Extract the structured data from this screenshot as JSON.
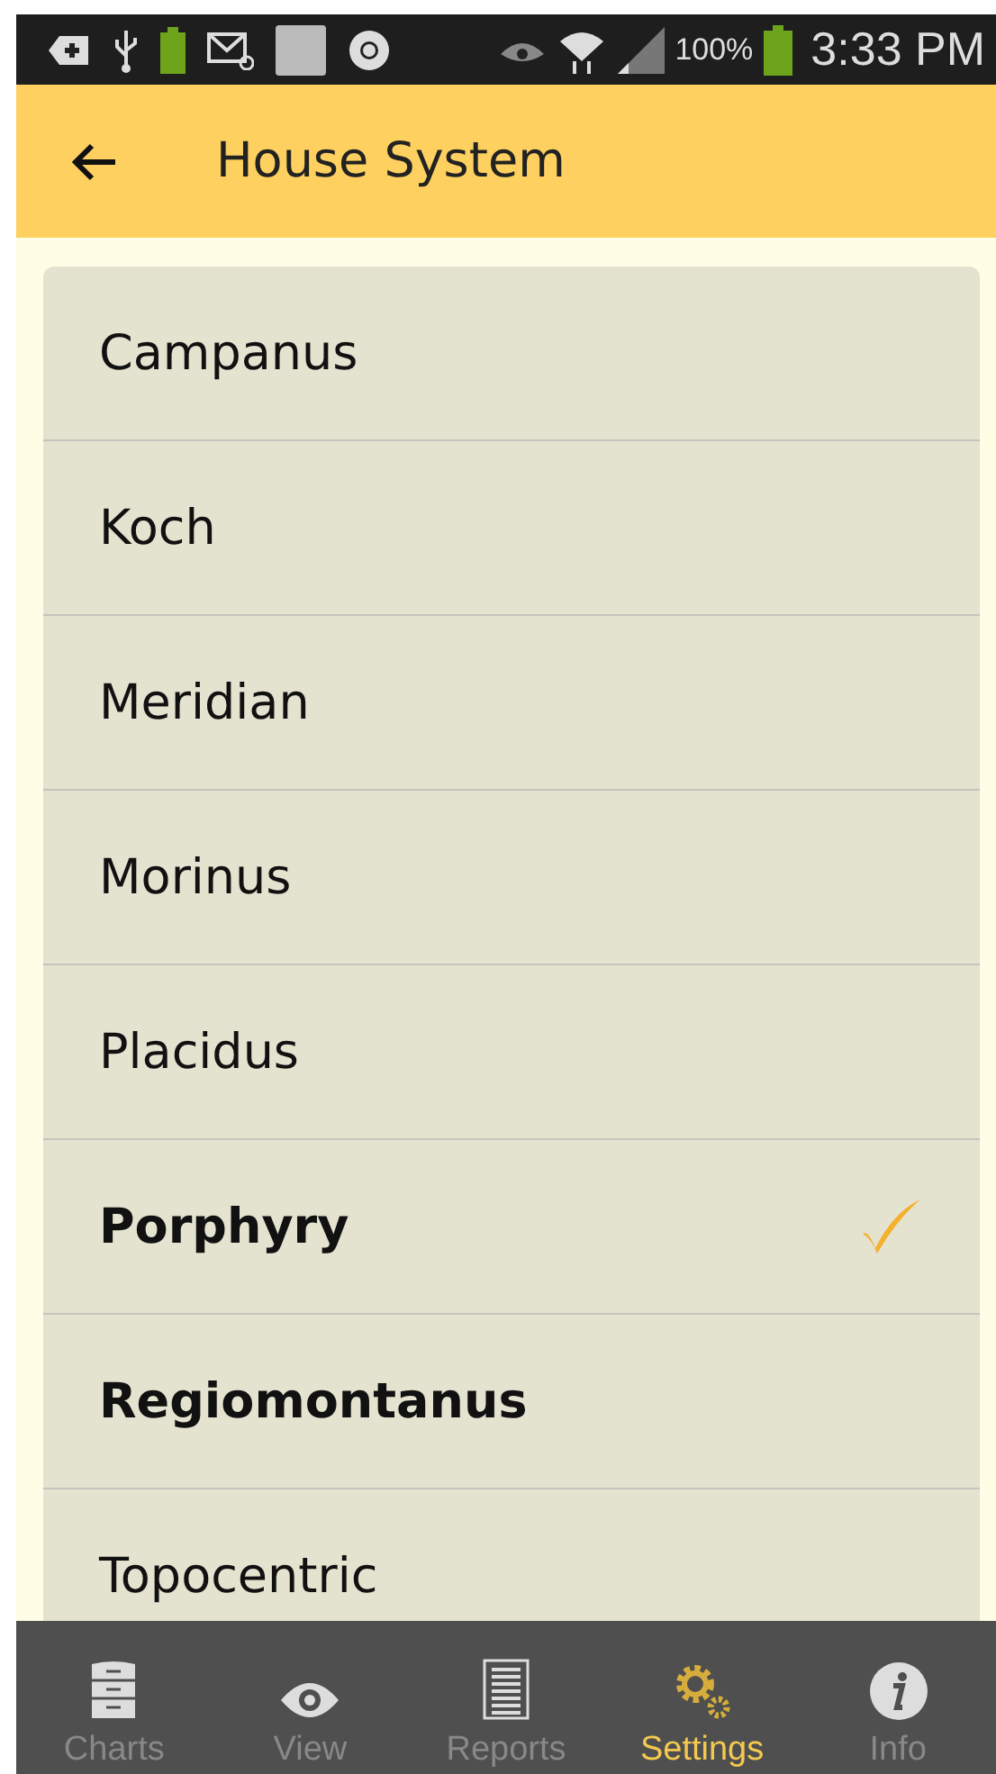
{
  "status_bar": {
    "battery": "100%",
    "time": "3:33 PM"
  },
  "app_bar": {
    "title": "House System"
  },
  "options": [
    {
      "label": "Campanus",
      "selected": false,
      "bold": false
    },
    {
      "label": "Koch",
      "selected": false,
      "bold": false
    },
    {
      "label": "Meridian",
      "selected": false,
      "bold": false
    },
    {
      "label": "Morinus",
      "selected": false,
      "bold": false
    },
    {
      "label": "Placidus",
      "selected": false,
      "bold": false
    },
    {
      "label": "Porphyry",
      "selected": true,
      "bold": true
    },
    {
      "label": "Regiomontanus",
      "selected": false,
      "bold": true
    },
    {
      "label": "Topocentric",
      "selected": false,
      "bold": false
    }
  ],
  "tabs": [
    {
      "label": "Charts",
      "kind": "cabinet",
      "selected": false
    },
    {
      "label": "View",
      "kind": "eye",
      "selected": false
    },
    {
      "label": "Reports",
      "kind": "document",
      "selected": false
    },
    {
      "label": "Settings",
      "kind": "gears",
      "selected": true
    },
    {
      "label": "Info",
      "kind": "info",
      "selected": false
    }
  ]
}
